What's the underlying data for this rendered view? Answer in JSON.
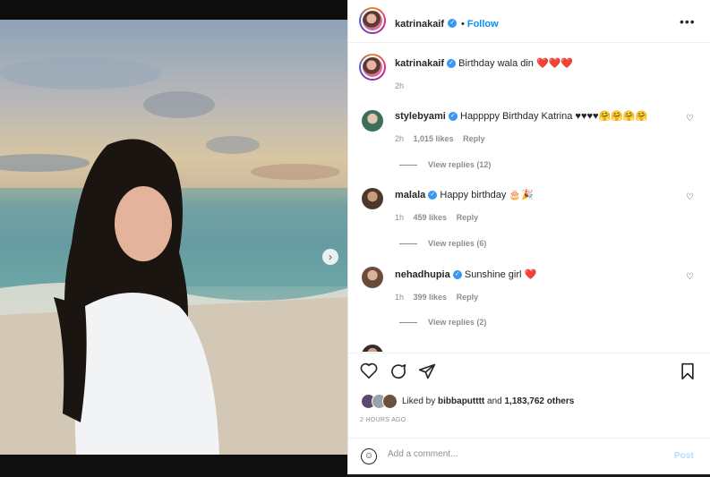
{
  "post": {
    "author": "katrinakaif",
    "follow_label": "Follow",
    "more_label": "•••",
    "caption": "Birthday wala din",
    "caption_emoji": "❤️❤️❤️",
    "caption_time": "2h"
  },
  "comments": [
    {
      "user": "stylebyami",
      "text": "Happppy Birthday Katrina ♥♥♥♥🤗🤗🤗🤗",
      "time": "2h",
      "likes": "1,015 likes",
      "reply": "Reply",
      "view_replies": "View replies (12)"
    },
    {
      "user": "malala",
      "text": "Happy birthday 🎂🎉",
      "time": "1h",
      "likes": "459 likes",
      "reply": "Reply",
      "view_replies": "View replies (6)"
    },
    {
      "user": "nehadhupia",
      "text": "Sunshine girl",
      "text_emoji": "❤️",
      "time": "1h",
      "likes": "399 likes",
      "reply": "Reply",
      "view_replies": "View replies (2)"
    }
  ],
  "actions": {
    "liked_by_prefix": "Liked by ",
    "liked_by_user": "bibbaputttt",
    "liked_by_suffix": " and ",
    "liked_others": "1,183,762 others",
    "time_ago": "2 HOURS AGO"
  },
  "add_comment": {
    "placeholder": "Add a comment...",
    "post_label": "Post"
  },
  "icons": [
    "verified-badge-icon",
    "heart-icon",
    "comment-icon",
    "share-icon",
    "bookmark-icon",
    "emoji-icon",
    "chevron-right-icon",
    "more-icon"
  ],
  "colors": {
    "accent": "#0095f6",
    "verified": "#3897f0",
    "heart": "#ed1c24",
    "muted": "#8e8e8e"
  },
  "carousel": {
    "slides": 4,
    "active": 1
  }
}
